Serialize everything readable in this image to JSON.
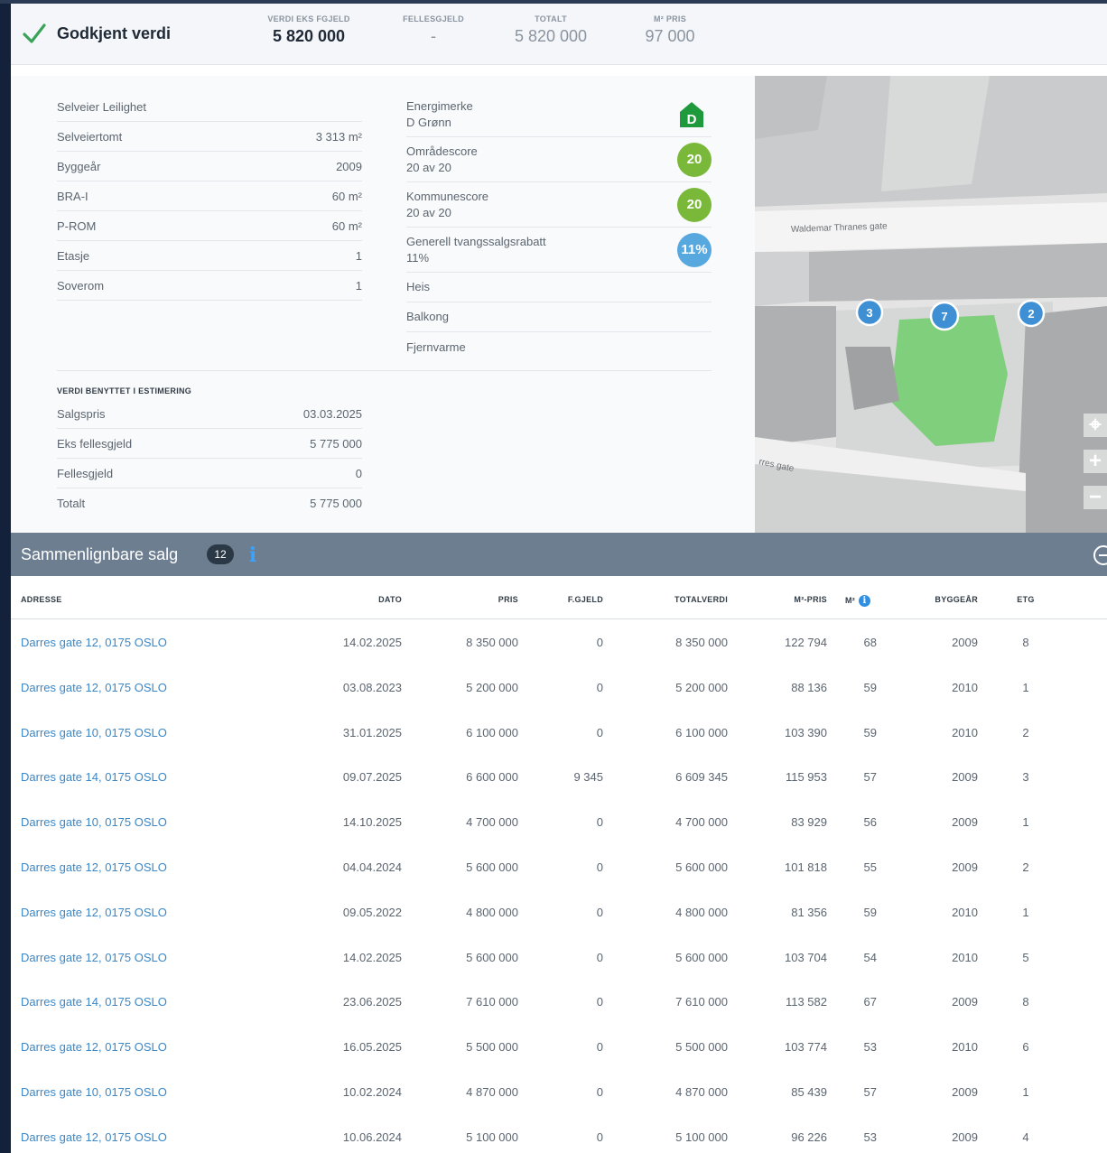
{
  "header": {
    "title": "Godkjent verdi",
    "stats": [
      {
        "label": "VERDI EKS FGJELD",
        "value": "5 820 000"
      },
      {
        "label": "FELLESGJELD",
        "value": "-"
      },
      {
        "label": "TOTALT",
        "value": "5 820 000"
      },
      {
        "label": "M² PRIS",
        "value": "97 000"
      }
    ]
  },
  "properties": [
    {
      "label": "Selveier Leilighet",
      "value": ""
    },
    {
      "label": "Selveiertomt",
      "value": "3 313 m²"
    },
    {
      "label": "Byggeår",
      "value": "2009"
    },
    {
      "label": "BRA-I",
      "value": "60 m²"
    },
    {
      "label": "P-ROM",
      "value": "60 m²"
    },
    {
      "label": "Etasje",
      "value": "1"
    },
    {
      "label": "Soverom",
      "value": "1"
    }
  ],
  "scores": {
    "energy": {
      "label": "Energimerke",
      "sub": "D Grønn",
      "letter": "D",
      "color": "#1e9a3c"
    },
    "area": {
      "label": "Områdescore",
      "sub": "20 av 20",
      "badge": "20",
      "color": "#7ab83a"
    },
    "municipality": {
      "label": "Kommunescore",
      "sub": "20 av 20",
      "badge": "20",
      "color": "#7ab83a"
    },
    "forced_sale": {
      "label": "Generell tvangssalgsrabatt",
      "sub": "11%",
      "badge": "11%",
      "color": "#58a8e0"
    },
    "features": [
      "Heis",
      "Balkong",
      "Fjernvarme"
    ]
  },
  "estimation": {
    "heading": "VERDI BENYTTET I ESTIMERING",
    "rows": [
      {
        "label": "Salgspris",
        "value": "03.03.2025"
      },
      {
        "label": "Eks fellesgjeld",
        "value": "5 775 000"
      },
      {
        "label": "Fellesgjeld",
        "value": "0"
      },
      {
        "label": "Totalt",
        "value": "5 775 000"
      }
    ]
  },
  "map": {
    "street": "Waldemar Thranes gate",
    "street2": "rres gate",
    "markers": [
      "3",
      "7",
      "2"
    ]
  },
  "comparables": {
    "title": "Sammenlignbare salg",
    "count": "12",
    "columns": [
      "ADRESSE",
      "DATO",
      "PRIS",
      "F.GJELD",
      "TOTALVERDI",
      "M²-PRIS",
      "M²",
      "BYGGEÅR",
      "ETG"
    ],
    "rows": [
      [
        "Darres gate 12, 0175 OSLO",
        "14.02.2025",
        "8 350 000",
        "0",
        "8 350 000",
        "122 794",
        "68",
        "2009",
        "8"
      ],
      [
        "Darres gate 12, 0175 OSLO",
        "03.08.2023",
        "5 200 000",
        "0",
        "5 200 000",
        "88 136",
        "59",
        "2010",
        "1"
      ],
      [
        "Darres gate 10, 0175 OSLO",
        "31.01.2025",
        "6 100 000",
        "0",
        "6 100 000",
        "103 390",
        "59",
        "2010",
        "2"
      ],
      [
        "Darres gate 14, 0175 OSLO",
        "09.07.2025",
        "6 600 000",
        "9 345",
        "6 609 345",
        "115 953",
        "57",
        "2009",
        "3"
      ],
      [
        "Darres gate 10, 0175 OSLO",
        "14.10.2025",
        "4 700 000",
        "0",
        "4 700 000",
        "83 929",
        "56",
        "2009",
        "1"
      ],
      [
        "Darres gate 12, 0175 OSLO",
        "04.04.2024",
        "5 600 000",
        "0",
        "5 600 000",
        "101 818",
        "55",
        "2009",
        "2"
      ],
      [
        "Darres gate 12, 0175 OSLO",
        "09.05.2022",
        "4 800 000",
        "0",
        "4 800 000",
        "81 356",
        "59",
        "2010",
        "1"
      ],
      [
        "Darres gate 12, 0175 OSLO",
        "14.02.2025",
        "5 600 000",
        "0",
        "5 600 000",
        "103 704",
        "54",
        "2010",
        "5"
      ],
      [
        "Darres gate 14, 0175 OSLO",
        "23.06.2025",
        "7 610 000",
        "0",
        "7 610 000",
        "113 582",
        "67",
        "2009",
        "8"
      ],
      [
        "Darres gate 12, 0175 OSLO",
        "16.05.2025",
        "5 500 000",
        "0",
        "5 500 000",
        "103 774",
        "53",
        "2010",
        "6"
      ],
      [
        "Darres gate 10, 0175 OSLO",
        "10.02.2024",
        "4 870 000",
        "0",
        "4 870 000",
        "85 439",
        "57",
        "2009",
        "1"
      ],
      [
        "Darres gate 12, 0175 OSLO",
        "10.06.2024",
        "5 100 000",
        "0",
        "5 100 000",
        "96 226",
        "53",
        "2009",
        "4"
      ]
    ]
  }
}
